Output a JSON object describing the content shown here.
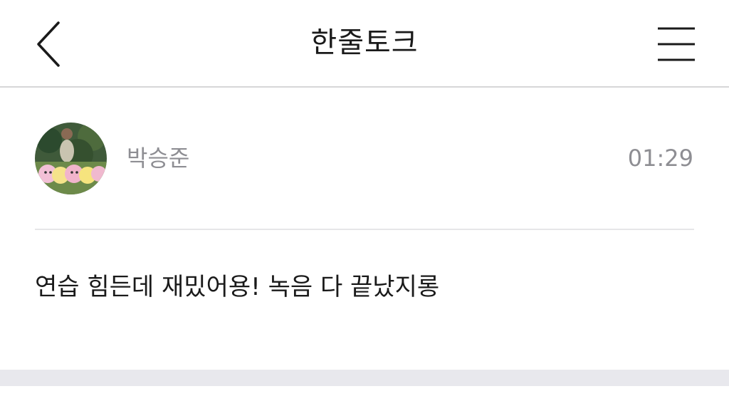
{
  "header": {
    "title": "한줄토크",
    "back_icon": "chevron-left-icon",
    "menu_icon": "hamburger-menu-icon"
  },
  "post": {
    "author": "박승준",
    "time": "01:29",
    "message": "연습 힘든데 재밌어용! 녹음 다 끝났지롱"
  },
  "colors": {
    "background": "#ffffff",
    "text_primary": "#1a1a1a",
    "text_secondary": "#8e8e93",
    "divider": "#e6e6e8",
    "band": "#e8e8ed"
  }
}
